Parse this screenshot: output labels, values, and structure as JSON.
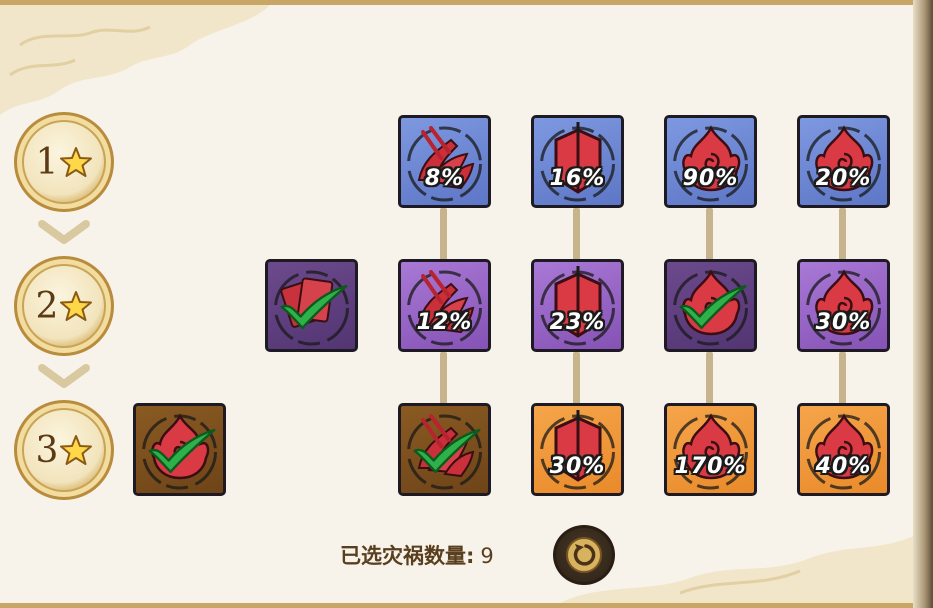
{
  "tiers": [
    {
      "label": "1"
    },
    {
      "label": "2"
    },
    {
      "label": "3"
    }
  ],
  "tiles": {
    "r1c1": {
      "percent": "8%",
      "icon": "claw-fire-icon"
    },
    "r1c2": {
      "percent": "16%",
      "icon": "shield-icon"
    },
    "r1c3": {
      "percent": "90%",
      "icon": "flame-spiral-icon"
    },
    "r1c4": {
      "percent": "20%",
      "icon": "flame-spiral-icon"
    },
    "r2c0": {
      "percent": "",
      "icon": "cards-icon",
      "selected": true
    },
    "r2c1": {
      "percent": "12%",
      "icon": "claw-fire-icon"
    },
    "r2c2": {
      "percent": "23%",
      "icon": "shield-icon"
    },
    "r2c3": {
      "percent": "",
      "icon": "flame-spiral-icon",
      "selected": true
    },
    "r2c4": {
      "percent": "30%",
      "icon": "flame-spiral-icon"
    },
    "r3c0": {
      "percent": "",
      "icon": "flame-spiral-icon",
      "selected": true
    },
    "r3c1": {
      "percent": "",
      "icon": "claw-fire-icon",
      "selected": true
    },
    "r3c2": {
      "percent": "30%",
      "icon": "shield-icon"
    },
    "r3c3": {
      "percent": "170%",
      "icon": "flame-spiral-icon"
    },
    "r3c4": {
      "percent": "40%",
      "icon": "flame-spiral-icon"
    }
  },
  "footer": {
    "selected_label": "已选灾祸数量:",
    "selected_count": "9",
    "reset_icon": "reset-arrow-icon"
  },
  "colors": {
    "tier1": "#6a82d2",
    "tier2": "#9563c4",
    "tier3": "#ee962f",
    "check": "#2fb14a"
  }
}
